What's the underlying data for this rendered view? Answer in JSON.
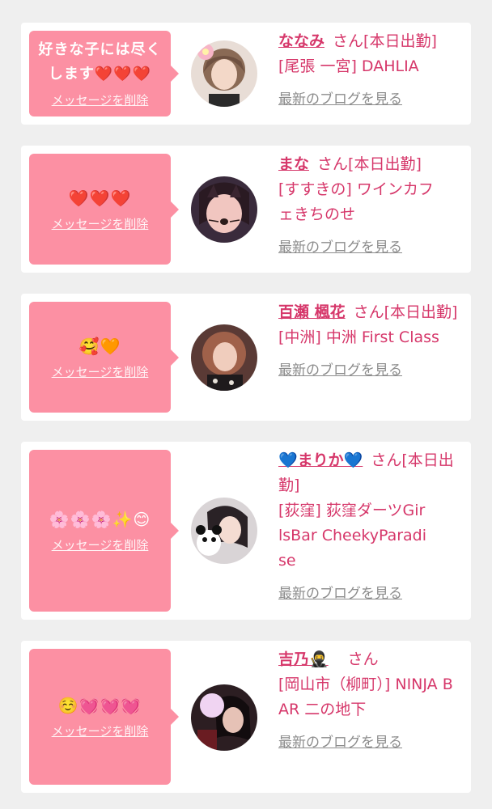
{
  "common": {
    "delete_label": "メッセージを削除",
    "blog_label": "最新のブログを見る",
    "san_label": "さん"
  },
  "cards": [
    {
      "message": "好きな子には尽くします❤️❤️❤️",
      "name": "ななみ",
      "status": "[本日出勤]",
      "location": "[尾張 一宮] DAHLIA"
    },
    {
      "message": "❤️❤️❤️",
      "name": "まな",
      "status": "[本日出勤]",
      "location": "[すすきの] ワインカフェきちのせ"
    },
    {
      "message": "🥰🧡",
      "name": "百瀬 楓花",
      "status": "[本日出勤]",
      "location": "[中洲] 中洲 First Class"
    },
    {
      "message": "🌸🌸🌸✨😊",
      "name": "💙まりか💙",
      "status": "[本日出勤]",
      "location": "[荻窪] 荻窪ダーツGirlsBar CheekyParadise"
    },
    {
      "message": "☺️💓💓💓",
      "name": "吉乃🥷",
      "status": "",
      "location": "[岡山市（柳町）] NINJA BAR 二の地下"
    }
  ],
  "colors": {
    "accent": "#d6376a",
    "bubble": "#fc90a3",
    "muted": "#8c8c8c",
    "card": "#ffffff",
    "background": "#efefef"
  }
}
